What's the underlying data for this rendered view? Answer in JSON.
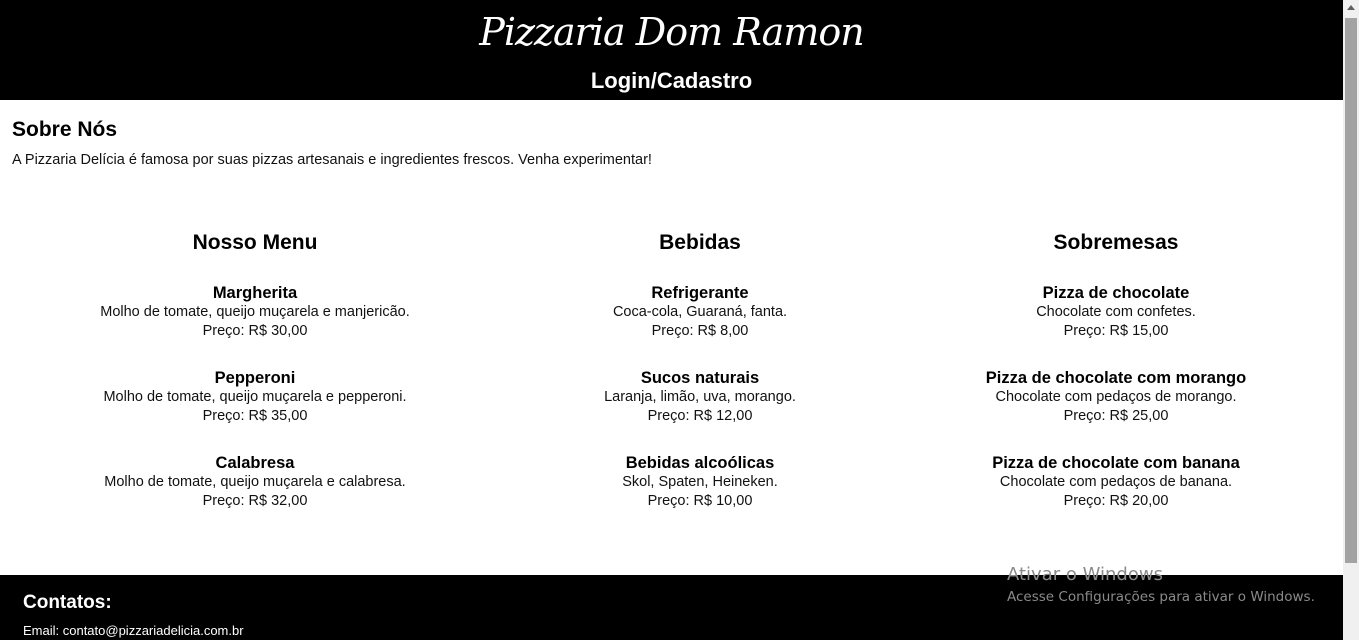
{
  "header": {
    "brand": "Pizzaria Dom Ramon",
    "login": "Login",
    "separator": "/",
    "register": "Cadastro"
  },
  "about": {
    "title": "Sobre Nós",
    "text": "A Pizzaria Delícia é famosa por suas pizzas artesanais e ingredientes frescos. Venha experimentar!"
  },
  "menus": [
    {
      "title": "Nosso Menu",
      "items": [
        {
          "name": "Margherita",
          "desc": "Molho de tomate, queijo muçarela e manjericão.",
          "price": "Preço: R$ 30,00"
        },
        {
          "name": "Pepperoni",
          "desc": "Molho de tomate, queijo muçarela e pepperoni.",
          "price": "Preço: R$ 35,00"
        },
        {
          "name": "Calabresa",
          "desc": "Molho de tomate, queijo muçarela e calabresa.",
          "price": "Preço: R$ 32,00"
        }
      ]
    },
    {
      "title": "Bebidas",
      "items": [
        {
          "name": "Refrigerante",
          "desc": "Coca-cola, Guaraná, fanta.",
          "price": "Preço: R$ 8,00"
        },
        {
          "name": "Sucos naturais",
          "desc": "Laranja, limão, uva, morango.",
          "price": "Preço: R$ 12,00"
        },
        {
          "name": "Bebidas alcoólicas",
          "desc": "Skol, Spaten, Heineken.",
          "price": "Preço: R$ 10,00"
        }
      ]
    },
    {
      "title": "Sobremesas",
      "items": [
        {
          "name": "Pizza de chocolate",
          "desc": "Chocolate com confetes.",
          "price": "Preço: R$ 15,00"
        },
        {
          "name": "Pizza de chocolate com morango",
          "desc": "Chocolate com pedaços de morango.",
          "price": "Preço: R$ 25,00"
        },
        {
          "name": "Pizza de chocolate com banana",
          "desc": "Chocolate com pedaços de banana.",
          "price": "Preço: R$ 20,00"
        }
      ]
    }
  ],
  "footer": {
    "title": "Contatos:",
    "email": "Email: contato@pizzariadelicia.com.br"
  },
  "watermark": {
    "title": "Ativar o Windows",
    "subtitle": "Acesse Configurações para ativar o Windows."
  },
  "colors": {
    "header_bg": "#000000",
    "footer_bg": "#000000",
    "text": "#000000"
  }
}
